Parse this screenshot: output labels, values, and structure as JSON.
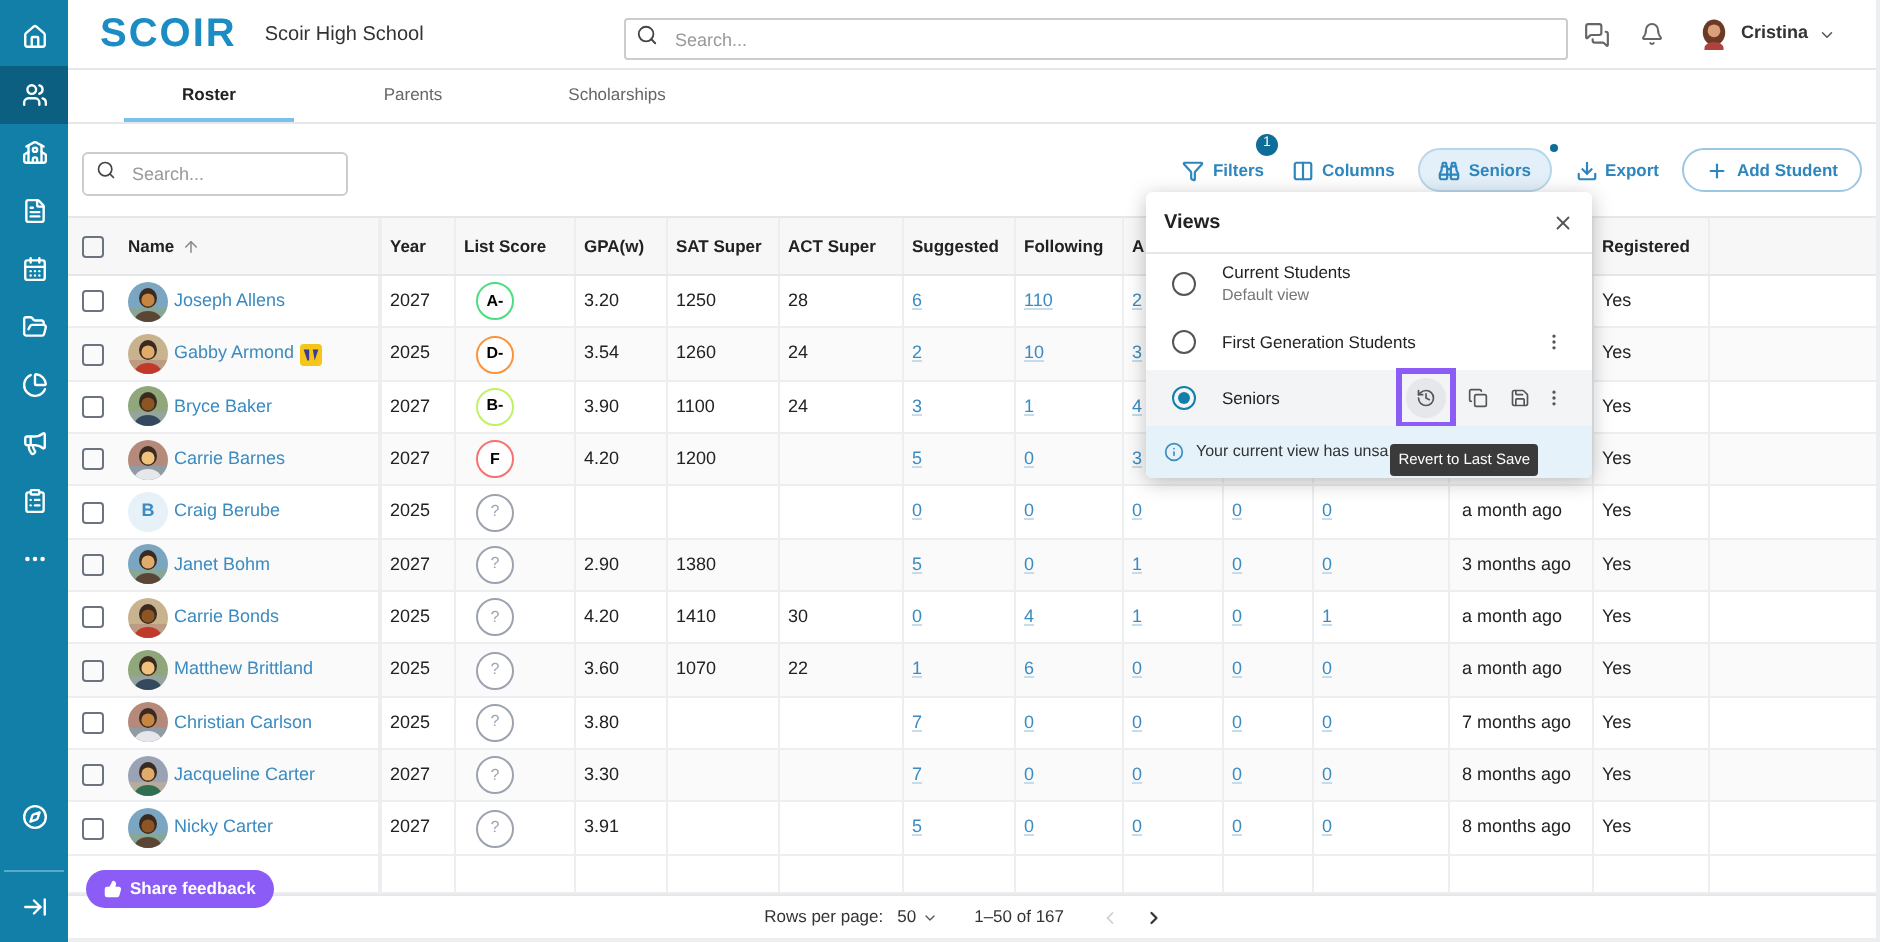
{
  "sidebar": {
    "items": [
      {
        "kind": "home",
        "selected": false
      },
      {
        "kind": "students",
        "selected": true
      },
      {
        "kind": "school",
        "selected": false
      },
      {
        "kind": "document",
        "selected": false
      },
      {
        "kind": "calendar",
        "selected": false
      },
      {
        "kind": "folder",
        "selected": false
      },
      {
        "kind": "chart",
        "selected": false
      },
      {
        "kind": "megaphone",
        "selected": false
      },
      {
        "kind": "list",
        "selected": false
      },
      {
        "kind": "more",
        "selected": false
      },
      {
        "kind": "compass",
        "selected": false
      },
      {
        "kind": "collapse",
        "selected": false
      }
    ]
  },
  "header": {
    "logo": "SCOIR",
    "school": "Scoir High School",
    "search": {
      "placeholder": "Search..."
    },
    "user": "Cristina"
  },
  "tabs": [
    {
      "label": "Roster",
      "selected": true
    },
    {
      "label": "Parents",
      "selected": false
    },
    {
      "label": "Scholarships",
      "selected": false
    }
  ],
  "toolbar": {
    "search": {
      "placeholder": "Search..."
    },
    "actions": [
      {
        "kind": "filters",
        "label": "Filters",
        "badge": "1"
      },
      {
        "kind": "columns",
        "label": "Columns"
      },
      {
        "kind": "view",
        "label": "Seniors",
        "selected": true,
        "unsaved": true
      },
      {
        "kind": "export",
        "label": "Export"
      },
      {
        "kind": "add",
        "label": "Add Student"
      }
    ]
  },
  "table": {
    "all_checked": false,
    "columns": [
      "Name",
      "Year",
      "List Score",
      "GPA(w)",
      "SAT Super",
      "ACT Super",
      "Suggested",
      "Following",
      "A"
    ],
    "registered_column": "Registered",
    "rows": [
      {
        "checked": false,
        "name": "Joseph Allens",
        "year": "2027",
        "score": {
          "grade": "A-",
          "color": "#4ade80"
        },
        "gpa": "3.20",
        "sat": "1250",
        "act": "28",
        "suggested": "6",
        "following": "110",
        "ap": "2",
        "registered": "Yes"
      },
      {
        "checked": false,
        "name": "Gabby Armond",
        "badge": true,
        "year": "2025",
        "score": {
          "grade": "D-",
          "color": "#fb923c"
        },
        "gpa": "3.54",
        "sat": "1260",
        "act": "24",
        "suggested": "2",
        "following": "10",
        "ap": "3",
        "registered": "Yes"
      },
      {
        "checked": false,
        "name": "Bryce Baker",
        "year": "2027",
        "score": {
          "grade": "B-",
          "color": "#bef264"
        },
        "gpa": "3.90",
        "sat": "1100",
        "act": "24",
        "suggested": "3",
        "following": "1",
        "ap": "4",
        "registered": "Yes"
      },
      {
        "checked": false,
        "name": "Carrie Barnes",
        "year": "2027",
        "score": {
          "grade": "F",
          "color": "#f87171"
        },
        "gpa": "4.20",
        "sat": "1200",
        "suggested": "5",
        "following": "0",
        "ap": "3",
        "registered": "Yes"
      },
      {
        "checked": false,
        "name": "Craig Berube",
        "avatar": {
          "kind": "initial",
          "initial": "B"
        },
        "year": "2025",
        "score": {
          "grade": "?",
          "color": "#9ca3af"
        },
        "suggested": "0",
        "following": "0",
        "ap": "0",
        "col_10": "0",
        "col_11": "0",
        "activity": "a month ago",
        "registered": "Yes"
      },
      {
        "checked": false,
        "name": "Janet Bohm",
        "year": "2027",
        "score": {
          "grade": "?",
          "color": "#9ca3af"
        },
        "gpa": "2.90",
        "sat": "1380",
        "suggested": "5",
        "following": "0",
        "ap": "1",
        "col_10": "0",
        "col_11": "0",
        "activity": "3 months ago",
        "registered": "Yes"
      },
      {
        "checked": false,
        "name": "Carrie Bonds",
        "year": "2025",
        "score": {
          "grade": "?",
          "color": "#9ca3af"
        },
        "gpa": "4.20",
        "sat": "1410",
        "act": "30",
        "suggested": "0",
        "following": "4",
        "ap": "1",
        "col_10": "0",
        "col_11": "1",
        "activity": "a month ago",
        "registered": "Yes"
      },
      {
        "checked": false,
        "name": "Matthew Brittland",
        "year": "2025",
        "score": {
          "grade": "?",
          "color": "#9ca3af"
        },
        "gpa": "3.60",
        "sat": "1070",
        "act": "22",
        "suggested": "1",
        "following": "6",
        "ap": "0",
        "col_10": "0",
        "col_11": "0",
        "activity": "a month ago",
        "registered": "Yes"
      },
      {
        "checked": false,
        "name": "Christian Carlson",
        "year": "2025",
        "score": {
          "grade": "?",
          "color": "#9ca3af"
        },
        "gpa": "3.80",
        "suggested": "7",
        "following": "0",
        "ap": "0",
        "col_10": "0",
        "col_11": "0",
        "activity": "7 months ago",
        "registered": "Yes"
      },
      {
        "checked": false,
        "name": "Jacqueline Carter",
        "year": "2027",
        "score": {
          "grade": "?",
          "color": "#9ca3af"
        },
        "gpa": "3.30",
        "suggested": "7",
        "following": "0",
        "ap": "0",
        "col_10": "0",
        "col_11": "0",
        "activity": "8 months ago",
        "registered": "Yes"
      },
      {
        "checked": false,
        "name": "Nicky Carter",
        "year": "2027",
        "score": {
          "grade": "?",
          "color": "#9ca3af"
        },
        "gpa": "3.91",
        "suggested": "5",
        "following": "0",
        "ap": "0",
        "col_10": "0",
        "col_11": "0",
        "activity": "8 months ago",
        "registered": "Yes"
      }
    ]
  },
  "views": {
    "title": "Views",
    "items": [
      {
        "name": "Current Students",
        "subtitle": "Default view",
        "selected": false,
        "menu": false,
        "actions": false
      },
      {
        "name": "First Generation Students",
        "selected": false,
        "menu": true,
        "actions": false
      },
      {
        "name": "Seniors",
        "selected": true,
        "menu": true,
        "actions": true
      }
    ],
    "notice": "Your current view has unsa",
    "tooltip": "Revert to Last Save"
  },
  "footer": {
    "feedback": "Share feedback",
    "rows_label": "Rows per page:",
    "rows_value": "50",
    "range": "1–50 of 167",
    "prev_disabled": true,
    "next_disabled": false
  }
}
